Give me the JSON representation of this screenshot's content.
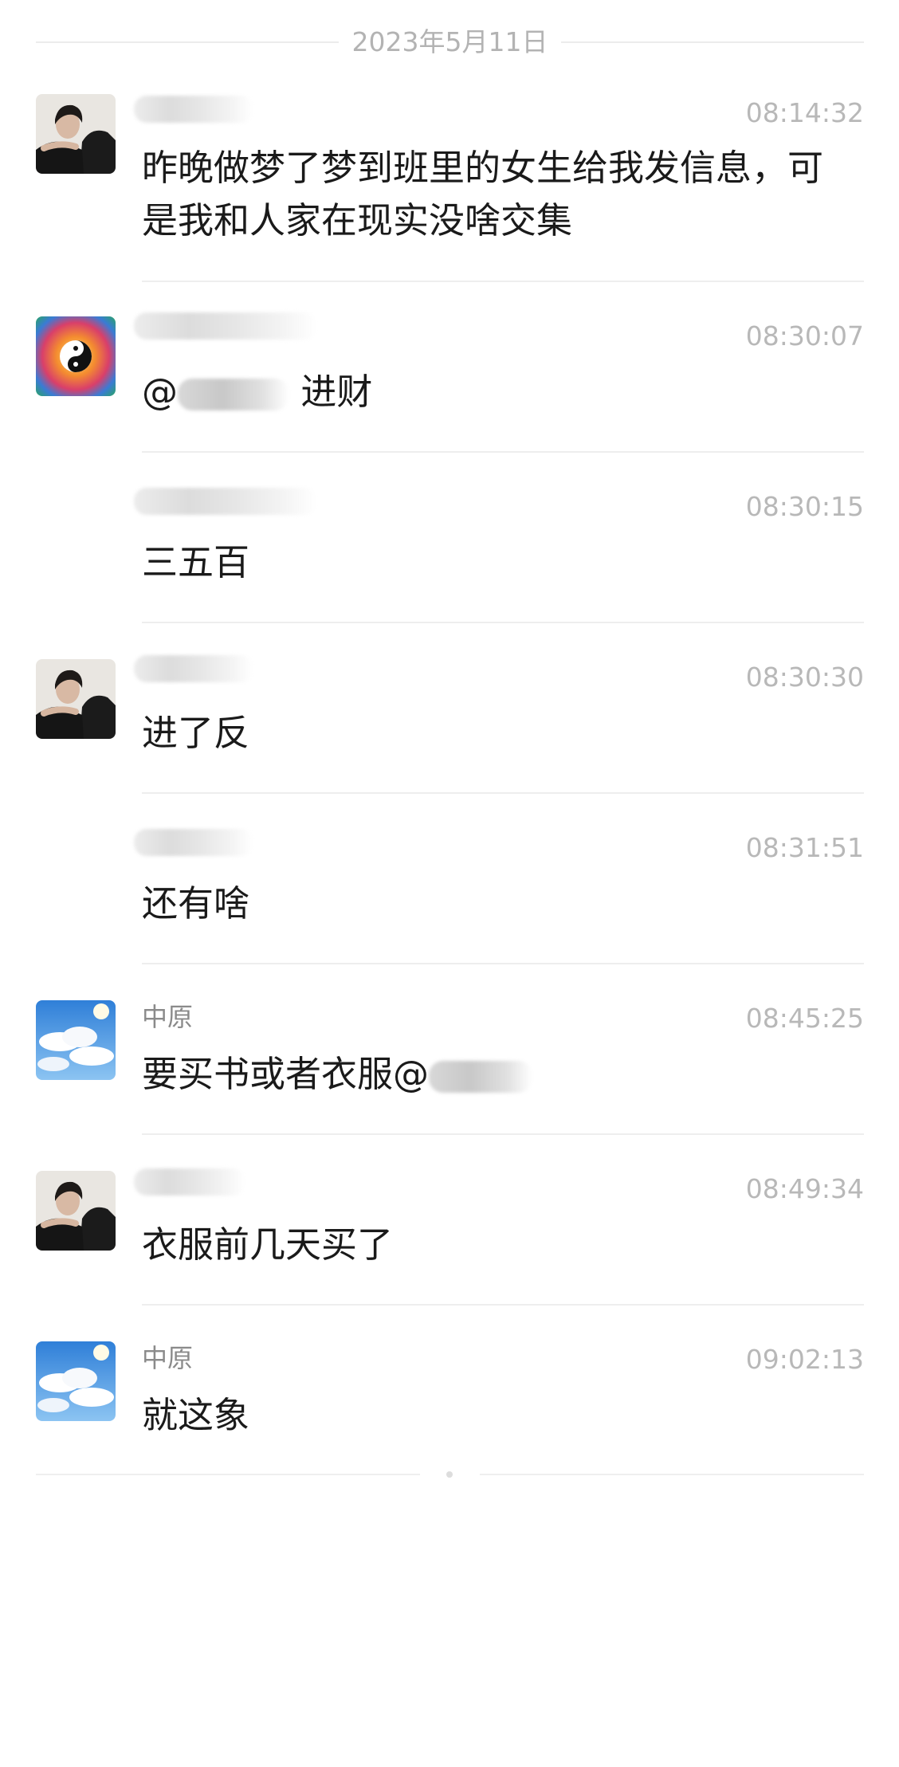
{
  "date_divider": "2023年5月11日",
  "messages": [
    {
      "sender": "",
      "time": "08:14:32",
      "text": "昨晚做梦了梦到班里的女生给我发信息，可是我和人家在现实没啥交集",
      "avatar": "portrait-avatar"
    },
    {
      "sender": "",
      "time": "08:30:07",
      "text_before": "@",
      "text_after": "进财",
      "avatar": "yin-yang-avatar"
    },
    {
      "sender": "",
      "time": "08:30:15",
      "text": "三五百",
      "avatar": ""
    },
    {
      "sender": "",
      "time": "08:30:30",
      "text": "进了反",
      "avatar": "portrait-avatar"
    },
    {
      "sender": "",
      "time": "08:31:51",
      "text": "还有啥",
      "avatar": ""
    },
    {
      "sender": "中原",
      "time": "08:45:25",
      "text": "要买书或者衣服@",
      "avatar": "sky-clouds-avatar"
    },
    {
      "sender": "",
      "time": "08:49:34",
      "text": "衣服前几天买了",
      "avatar": "portrait-avatar"
    },
    {
      "sender": "中原",
      "time": "09:02:13",
      "text": "就这象",
      "avatar": "sky-clouds-avatar"
    }
  ]
}
